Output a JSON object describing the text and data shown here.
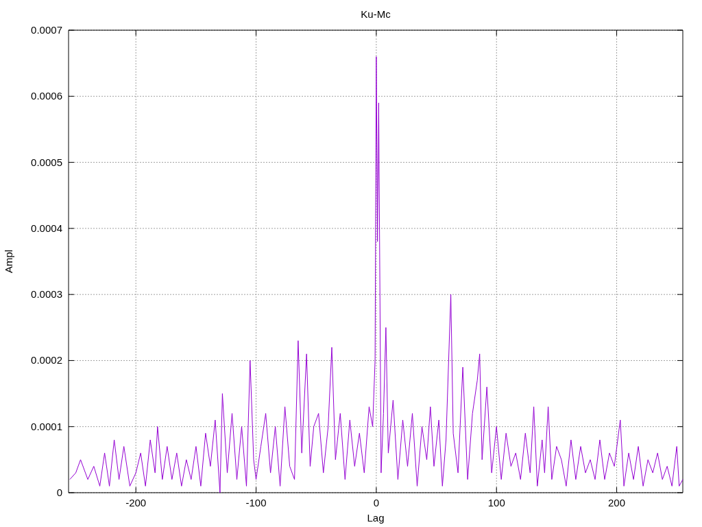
{
  "chart_data": {
    "type": "line",
    "title": "Ku-Mc",
    "xlabel": "Lag",
    "ylabel": "Ampl",
    "xlim": [
      -256,
      255
    ],
    "ylim": [
      0,
      0.0007
    ],
    "grid": true,
    "xticks": [
      -200,
      -100,
      0,
      100,
      200
    ],
    "yticks": [
      0,
      0.0001,
      0.0002,
      0.0003,
      0.0004,
      0.0005,
      0.0006,
      0.0007
    ],
    "x": [
      -255,
      -250,
      -246,
      -240,
      -235,
      -230,
      -226,
      -222,
      -218,
      -214,
      -210,
      -205,
      -200,
      -196,
      -192,
      -188,
      -184,
      -182,
      -178,
      -174,
      -170,
      -166,
      -162,
      -158,
      -154,
      -150,
      -146,
      -142,
      -138,
      -134,
      -130,
      -128,
      -124,
      -120,
      -116,
      -112,
      -108,
      -105,
      -102,
      -100,
      -96,
      -92,
      -88,
      -84,
      -80,
      -76,
      -72,
      -68,
      -65,
      -62,
      -58,
      -55,
      -52,
      -48,
      -44,
      -40,
      -37,
      -34,
      -30,
      -26,
      -22,
      -18,
      -14,
      -10,
      -6,
      -3,
      -1,
      0,
      1,
      2,
      4,
      6,
      8,
      10,
      14,
      18,
      22,
      26,
      30,
      34,
      38,
      42,
      45,
      48,
      52,
      55,
      58,
      62,
      64,
      68,
      72,
      76,
      80,
      84,
      86,
      88,
      92,
      96,
      100,
      104,
      108,
      112,
      116,
      120,
      124,
      128,
      131,
      134,
      138,
      140,
      143,
      146,
      150,
      154,
      158,
      162,
      166,
      170,
      174,
      178,
      182,
      186,
      190,
      194,
      198,
      203,
      206,
      210,
      214,
      218,
      222,
      226,
      230,
      234,
      238,
      242,
      246,
      250,
      252,
      255
    ],
    "series": [
      {
        "color": "#9400d3",
        "values": [
          2e-05,
          3e-05,
          5e-05,
          2e-05,
          4e-05,
          1e-05,
          6e-05,
          1e-05,
          8e-05,
          2e-05,
          7e-05,
          1e-05,
          3e-05,
          6e-05,
          1e-05,
          8e-05,
          3e-05,
          0.0001,
          2e-05,
          7e-05,
          2e-05,
          6e-05,
          1e-05,
          5e-05,
          2e-05,
          7e-05,
          1e-05,
          9e-05,
          4e-05,
          0.00011,
          0,
          0.00015,
          3e-05,
          0.00012,
          2e-05,
          0.0001,
          1e-05,
          0.0002,
          5e-05,
          2e-05,
          7e-05,
          0.00012,
          3e-05,
          0.0001,
          1e-05,
          0.00013,
          4e-05,
          2e-05,
          0.00023,
          6e-05,
          0.00021,
          4e-05,
          0.0001,
          0.00012,
          3e-05,
          0.0001,
          0.00022,
          5e-05,
          0.00012,
          2e-05,
          0.00011,
          4e-05,
          9e-05,
          3e-05,
          0.00013,
          0.0001,
          0.0002,
          0.00066,
          0.00038,
          0.00059,
          3e-05,
          0.00012,
          0.00025,
          6e-05,
          0.00014,
          2e-05,
          0.00011,
          4e-05,
          0.00012,
          1e-05,
          0.0001,
          5e-05,
          0.00013,
          4e-05,
          0.00011,
          1e-05,
          8e-05,
          0.0003,
          9e-05,
          3e-05,
          0.00019,
          2e-05,
          0.00012,
          0.00017,
          0.00021,
          5e-05,
          0.00016,
          3e-05,
          0.0001,
          2e-05,
          9e-05,
          4e-05,
          6e-05,
          2e-05,
          9e-05,
          3e-05,
          0.00013,
          1e-05,
          8e-05,
          3e-05,
          0.00013,
          2e-05,
          7e-05,
          5e-05,
          1e-05,
          8e-05,
          2e-05,
          7e-05,
          3e-05,
          5e-05,
          2e-05,
          8e-05,
          2e-05,
          6e-05,
          4e-05,
          0.00011,
          1e-05,
          6e-05,
          2e-05,
          7e-05,
          1e-05,
          5e-05,
          3e-05,
          6e-05,
          2e-05,
          4e-05,
          1e-05,
          7e-05,
          1e-05,
          2e-05
        ]
      }
    ]
  }
}
